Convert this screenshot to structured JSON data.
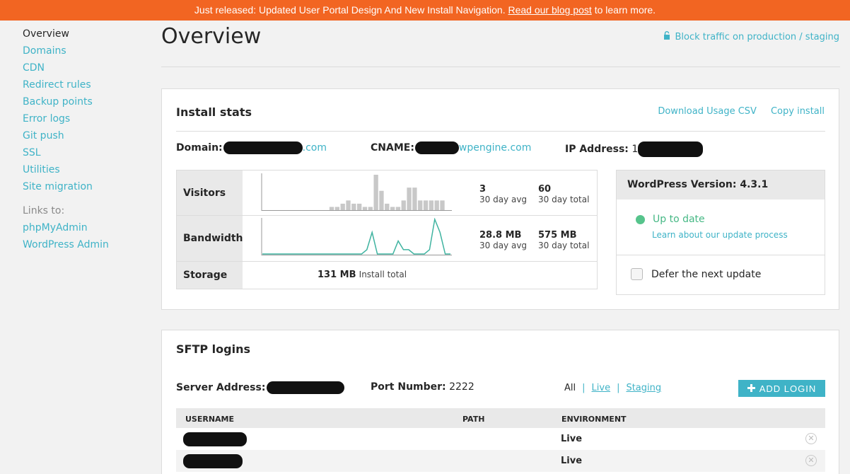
{
  "banner": {
    "text_before": "Just released: Updated User Portal Design And New Install Navigation. ",
    "link": "Read our blog post",
    "text_after": " to learn more."
  },
  "sidebar": {
    "items": [
      {
        "label": "Overview"
      },
      {
        "label": "Domains"
      },
      {
        "label": "CDN"
      },
      {
        "label": "Redirect rules"
      },
      {
        "label": "Backup points"
      },
      {
        "label": "Error logs"
      },
      {
        "label": "Git push"
      },
      {
        "label": "SSL"
      },
      {
        "label": "Utilities"
      },
      {
        "label": "Site migration"
      }
    ],
    "links_label": "Links to:",
    "links": [
      {
        "label": "phpMyAdmin"
      },
      {
        "label": "WordPress Admin"
      }
    ]
  },
  "header": {
    "title": "Overview",
    "block_traffic": "Block traffic on production / staging"
  },
  "install_stats": {
    "title": "Install stats",
    "download_csv": "Download Usage CSV",
    "copy_install": "Copy install",
    "domain_label": "Domain:",
    "domain_suffix": ".com",
    "cname_label": "CNAME:",
    "cname_suffix": "wpengine.com",
    "ip_label": "IP Address:",
    "ip_prefix": "1",
    "visitors": {
      "label": "Visitors",
      "avg": "3",
      "avg_caption": "30 day avg",
      "total": "60",
      "total_caption": "30 day total",
      "spark": [
        0,
        0,
        0,
        0,
        0,
        0,
        0,
        0,
        0,
        0,
        0,
        0,
        1,
        1,
        2,
        3,
        2,
        2,
        1,
        1,
        11,
        6,
        2,
        1,
        1,
        3,
        7,
        7,
        3,
        3,
        3,
        3,
        3,
        0
      ]
    },
    "bandwidth": {
      "label": "Bandwidth",
      "avg": "28.8 MB",
      "avg_caption": "30 day avg",
      "total": "575 MB",
      "total_caption": "30 day total",
      "spark": [
        0,
        0,
        0,
        0,
        0,
        0,
        0,
        0,
        0,
        0,
        0,
        0,
        0,
        0,
        0,
        0,
        0,
        0,
        0,
        0,
        1,
        5,
        0,
        0,
        0,
        0,
        3,
        1,
        1,
        0,
        0,
        0,
        1,
        8,
        5,
        0,
        0
      ]
    },
    "storage": {
      "label": "Storage",
      "value": "131 MB",
      "caption": "Install total"
    }
  },
  "wordpress": {
    "version": "WordPress Version: 4.3.1",
    "status": "Up to date",
    "learn": "Learn about our update process",
    "defer": "Defer the next update"
  },
  "sftp": {
    "title": "SFTP logins",
    "server_label": "Server Address:",
    "port_label": "Port Number:",
    "port_value": "2222",
    "filter_all": "All",
    "filter_sep": "|",
    "filter_live": "Live",
    "filter_staging": "Staging",
    "add_login": "ADD LOGIN",
    "columns": {
      "username": "USERNAME",
      "path": "PATH",
      "environment": "ENVIRONMENT"
    },
    "rows": [
      {
        "environment": "Live"
      },
      {
        "environment": "Live"
      }
    ]
  },
  "colors": {
    "banner": "#f26522",
    "accent": "#3fb3c7",
    "status_ok": "#56c48c",
    "spark_bar": "#c8c8c8",
    "spark_line": "#3fb3a0"
  },
  "icons": {
    "block_traffic": "lock-icon",
    "status": "status-dot-icon",
    "add": "plus-icon",
    "delete": "remove-circle-icon"
  }
}
